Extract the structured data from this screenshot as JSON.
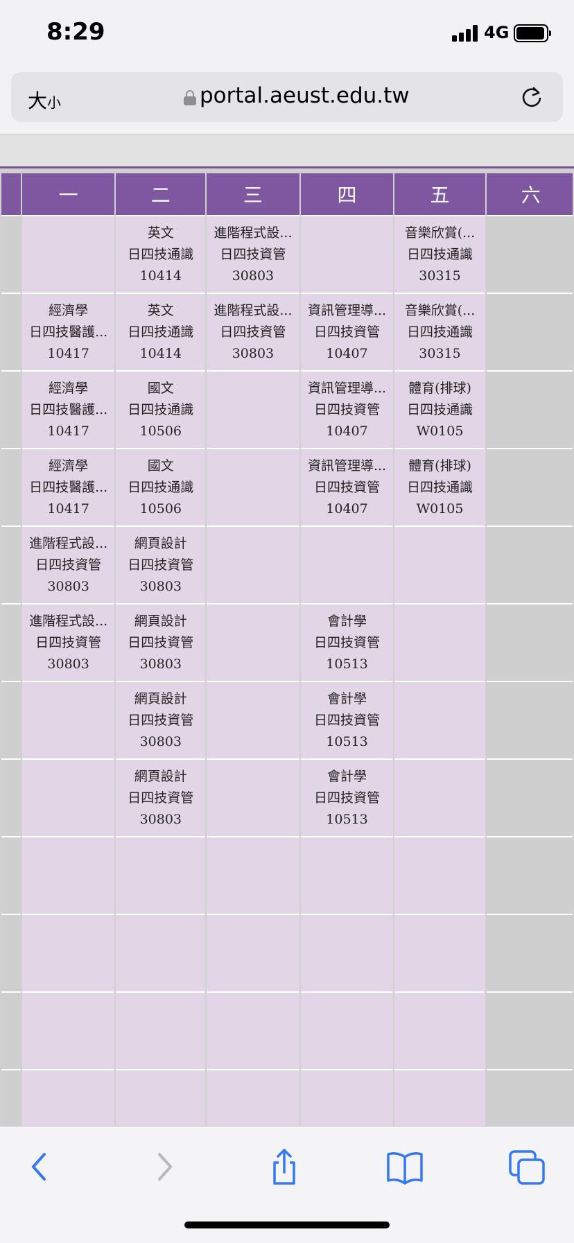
{
  "status_bar": {
    "time": "8:29",
    "network": "4G"
  },
  "browser": {
    "text_size_label_large": "大",
    "text_size_label_small": "小",
    "url": "portal.aeust.edu.tw",
    "accent_color": "#3478f6"
  },
  "schedule": {
    "header_color": "#7f57a0",
    "cell_color": "#e2d6e6",
    "days": [
      "一",
      "二",
      "三",
      "四",
      "五",
      "六"
    ],
    "rows": [
      [
        null,
        {
          "course": "英文",
          "class": "日四技通識",
          "room": "10414"
        },
        {
          "course": "進階程式設...",
          "class": "日四技資管",
          "room": "30803"
        },
        null,
        {
          "course": "音樂欣賞(...",
          "class": "日四技通識",
          "room": "30315"
        }
      ],
      [
        {
          "course": "經濟學",
          "class": "日四技醫護...",
          "room": "10417"
        },
        {
          "course": "英文",
          "class": "日四技通識",
          "room": "10414"
        },
        {
          "course": "進階程式設...",
          "class": "日四技資管",
          "room": "30803"
        },
        {
          "course": "資訊管理導...",
          "class": "日四技資管",
          "room": "10407"
        },
        {
          "course": "音樂欣賞(...",
          "class": "日四技通識",
          "room": "30315"
        }
      ],
      [
        {
          "course": "經濟學",
          "class": "日四技醫護...",
          "room": "10417"
        },
        {
          "course": "國文",
          "class": "日四技通識",
          "room": "10506"
        },
        null,
        {
          "course": "資訊管理導...",
          "class": "日四技資管",
          "room": "10407"
        },
        {
          "course": "體育(排球)",
          "class": "日四技通識",
          "room": "W0105"
        }
      ],
      [
        {
          "course": "經濟學",
          "class": "日四技醫護...",
          "room": "10417"
        },
        {
          "course": "國文",
          "class": "日四技通識",
          "room": "10506"
        },
        null,
        {
          "course": "資訊管理導...",
          "class": "日四技資管",
          "room": "10407"
        },
        {
          "course": "體育(排球)",
          "class": "日四技通識",
          "room": "W0105"
        }
      ],
      [
        {
          "course": "進階程式設...",
          "class": "日四技資管",
          "room": "30803"
        },
        {
          "course": "網頁設計",
          "class": "日四技資管",
          "room": "30803"
        },
        null,
        null,
        null
      ],
      [
        {
          "course": "進階程式設...",
          "class": "日四技資管",
          "room": "30803"
        },
        {
          "course": "網頁設計",
          "class": "日四技資管",
          "room": "30803"
        },
        null,
        {
          "course": "會計學",
          "class": "日四技資管",
          "room": "10513"
        },
        null
      ],
      [
        null,
        {
          "course": "網頁設計",
          "class": "日四技資管",
          "room": "30803"
        },
        null,
        {
          "course": "會計學",
          "class": "日四技資管",
          "room": "10513"
        },
        null
      ],
      [
        null,
        {
          "course": "網頁設計",
          "class": "日四技資管",
          "room": "30803"
        },
        null,
        {
          "course": "會計學",
          "class": "日四技資管",
          "room": "10513"
        },
        null
      ],
      [
        null,
        null,
        null,
        null,
        null
      ],
      [
        null,
        null,
        null,
        null,
        null
      ],
      [
        null,
        null,
        null,
        null,
        null
      ],
      [
        null,
        null,
        null,
        null,
        null
      ]
    ]
  },
  "toolbar": {
    "icons": [
      "back-icon",
      "forward-icon",
      "share-icon",
      "bookmarks-icon",
      "tabs-icon"
    ]
  }
}
